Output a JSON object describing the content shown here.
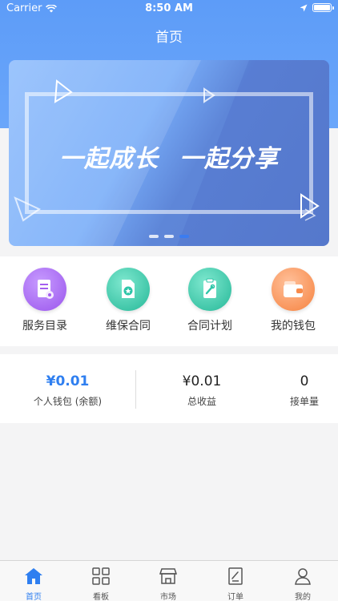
{
  "status_bar": {
    "carrier": "Carrier",
    "time": "8:50 AM"
  },
  "nav": {
    "title": "首页"
  },
  "banner": {
    "slogan_left": "一起成长",
    "slogan_right": "一起分享",
    "active_dot": 2
  },
  "menu": {
    "items": [
      {
        "label": "服务目录",
        "icon": "service-catalog-icon",
        "color": "#a45df0"
      },
      {
        "label": "维保合同",
        "icon": "maintenance-contract-icon",
        "color": "#2ec5a8"
      },
      {
        "label": "合同计划",
        "icon": "contract-plan-icon",
        "color": "#2ec5a8"
      },
      {
        "label": "我的钱包",
        "icon": "wallet-icon",
        "color": "#f88a4a"
      }
    ]
  },
  "stats": {
    "wallet": {
      "value": "¥0.01",
      "label": "个人钱包 (余额)"
    },
    "income": {
      "value": "¥0.01",
      "label": "总收益"
    },
    "orders": {
      "value": "0",
      "label": "接单量"
    }
  },
  "tabbar": {
    "items": [
      {
        "label": "首页",
        "icon": "home-icon",
        "active": true
      },
      {
        "label": "看板",
        "icon": "dashboard-icon",
        "active": false
      },
      {
        "label": "市场",
        "icon": "market-icon",
        "active": false
      },
      {
        "label": "订单",
        "icon": "order-icon",
        "active": false
      },
      {
        "label": "我的",
        "icon": "profile-icon",
        "active": false
      }
    ]
  },
  "colors": {
    "primary": "#2f7ff0",
    "header": "#5d9cf8"
  }
}
